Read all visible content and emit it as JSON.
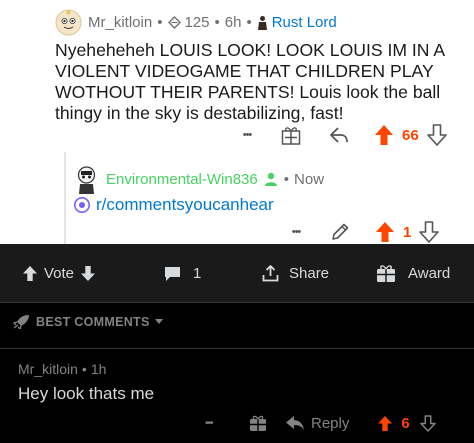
{
  "parent_comment": {
    "username": "Mr_kitloin",
    "karma": "125",
    "age": "6h",
    "flair": "Rust Lord",
    "body": "Nyeheheheh LOUIS LOOK! LOOK LOUIS IM IN A VIOLENT VIDEOGAME THAT CHILDREN PLAY WOTHOUT THEIR PARENTS! Louis look the ball thingy in the sky is destabilizing, fast!",
    "score": "66",
    "more_label": "•••"
  },
  "reply_comment": {
    "username": "Environmental-Win836",
    "age": "Now",
    "link": "r/commentsyoucanhear",
    "score": "1",
    "more_label": "•••"
  },
  "vote_bar": {
    "vote_label": "Vote",
    "comment_count": "1",
    "share_label": "Share",
    "award_label": "Award"
  },
  "sort": {
    "label": "BEST COMMENTS"
  },
  "bottom_comment": {
    "username": "Mr_kitloin",
    "age": "1h",
    "body": "Hey look thats me",
    "reply_label": "Reply",
    "score": "6",
    "more_label": "•••"
  },
  "colors": {
    "upvote": "#ff4500",
    "link": "#0079d3",
    "op_user": "#46d160",
    "dark_bg": "#000000",
    "bar_bg": "#1a1a1b"
  }
}
